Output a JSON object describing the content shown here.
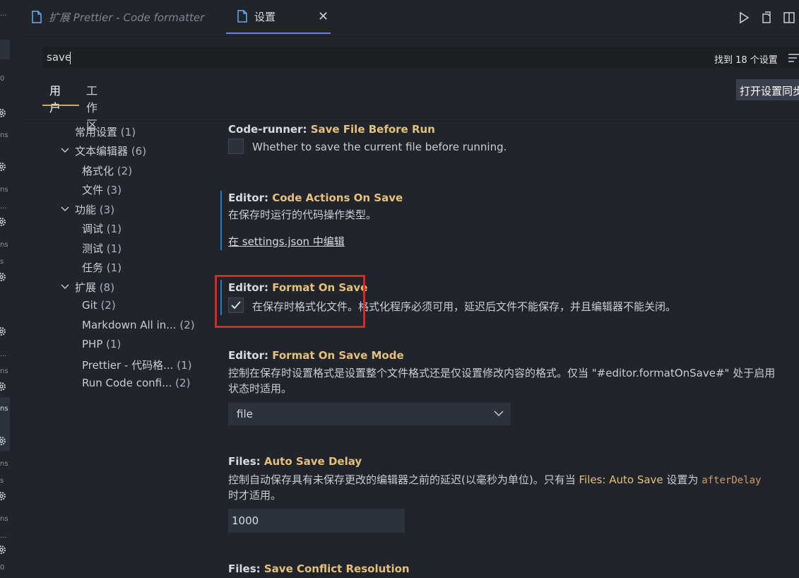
{
  "tabs": {
    "prettier": "扩展 Prettier - Code formatter",
    "settings": "设置",
    "close": "✕"
  },
  "search": {
    "value": "save",
    "result_count": "找到 18 个设置"
  },
  "scope": {
    "user": "用户",
    "workspace": "工作区",
    "sync_button": "打开设置同步"
  },
  "toc": [
    {
      "label": "常用设置",
      "count": "(1)"
    },
    {
      "label": "文本编辑器",
      "count": "(6)"
    },
    {
      "label": "格式化",
      "count": "(2)"
    },
    {
      "label": "文件",
      "count": "(3)"
    },
    {
      "label": "功能",
      "count": "(3)"
    },
    {
      "label": "调试",
      "count": "(1)"
    },
    {
      "label": "测试",
      "count": "(1)"
    },
    {
      "label": "任务",
      "count": "(1)"
    },
    {
      "label": "扩展",
      "count": "(8)"
    },
    {
      "label": "Git",
      "count": "(2)"
    },
    {
      "label": "Markdown All in...",
      "count": "(2)"
    },
    {
      "label": "PHP",
      "count": "(1)"
    },
    {
      "label": "Prettier - 代码格...",
      "count": "(1)"
    },
    {
      "label": "Run Code confi...",
      "count": "(2)"
    }
  ],
  "settings": {
    "s1": {
      "category": "Code-runner: ",
      "key": "Save File Before Run",
      "desc": "Whether to save the current file before running.",
      "checked": false
    },
    "s2": {
      "category": "Editor: ",
      "key": "Code Actions On Save",
      "desc": "在保存时运行的代码操作类型。",
      "link": "在 settings.json 中编辑"
    },
    "s3": {
      "category": "Editor: ",
      "key": "Format On Save",
      "desc": "在保存时格式化文件。格式化程序必须可用，延迟后文件不能保存，并且编辑器不能关闭。",
      "checked": true
    },
    "s4": {
      "category": "Editor: ",
      "key": "Format On Save Mode",
      "desc_line1": "控制在保存时设置格式是设置整个文件格式还是仅设置修改内容的格式。仅当 \"#editor.formatOnSave#\" 处于启用",
      "desc_line2": "状态时适用。",
      "value": "file"
    },
    "s5": {
      "category": "Files: ",
      "key": "Auto Save Delay",
      "desc_pre": "控制自动保存具有未保存更改的编辑器之前的延迟(以毫秒为单位)。只有当 ",
      "desc_ref": "Files: Auto Save",
      "desc_mid": " 设置为 ",
      "desc_code": "afterDelay",
      "desc_line2": "时才适用。",
      "value": "1000"
    },
    "s6": {
      "category": "Files: ",
      "key": "Save Conflict Resolution"
    }
  },
  "side_labels": [
    "...",
    "0",
    "ns",
    "ns",
    "...",
    "ns",
    "s",
    "...",
    "ns",
    "ns",
    "ns",
    "s",
    "ns",
    "...",
    "0"
  ],
  "colors": {
    "accent_blue": "#528bff",
    "setting_key": "#e5c07b",
    "highlight_box": "#e02424"
  }
}
